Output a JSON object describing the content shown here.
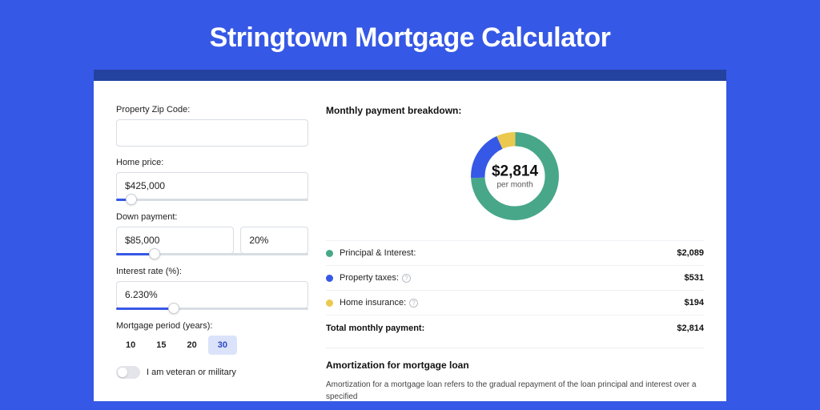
{
  "title": "Stringtown Mortgage Calculator",
  "form": {
    "zip": {
      "label": "Property Zip Code:",
      "value": ""
    },
    "home_price": {
      "label": "Home price:",
      "value": "$425,000",
      "slider_pct": 8
    },
    "down_payment": {
      "label": "Down payment:",
      "value": "$85,000",
      "percent": "20%",
      "slider_pct": 20
    },
    "interest_rate": {
      "label": "Interest rate (%):",
      "value": "6.230%",
      "slider_pct": 30
    },
    "period": {
      "label": "Mortgage period (years):",
      "options": [
        "10",
        "15",
        "20",
        "30"
      ],
      "selected": "30"
    },
    "veteran": {
      "label": "I am veteran or military",
      "checked": false
    }
  },
  "breakdown": {
    "title": "Monthly payment breakdown:",
    "center_amount": "$2,814",
    "center_sub": "per month",
    "items": [
      {
        "label": "Principal & Interest:",
        "value": "$2,089",
        "color": "#48a789",
        "help": false
      },
      {
        "label": "Property taxes:",
        "value": "$531",
        "color": "#3658e6",
        "help": true
      },
      {
        "label": "Home insurance:",
        "value": "$194",
        "color": "#eac94e",
        "help": true
      }
    ],
    "total_label": "Total monthly payment:",
    "total_value": "$2,814"
  },
  "chart_data": {
    "type": "pie",
    "title": "Monthly payment breakdown",
    "series": [
      {
        "name": "Principal & Interest",
        "value": 2089,
        "color": "#48a789"
      },
      {
        "name": "Property taxes",
        "value": 531,
        "color": "#3658e6"
      },
      {
        "name": "Home insurance",
        "value": 194,
        "color": "#eac94e"
      }
    ],
    "total": 2814,
    "center_label": "$2,814 per month"
  },
  "amortization": {
    "title": "Amortization for mortgage loan",
    "text": "Amortization for a mortgage loan refers to the gradual repayment of the loan principal and interest over a specified"
  }
}
